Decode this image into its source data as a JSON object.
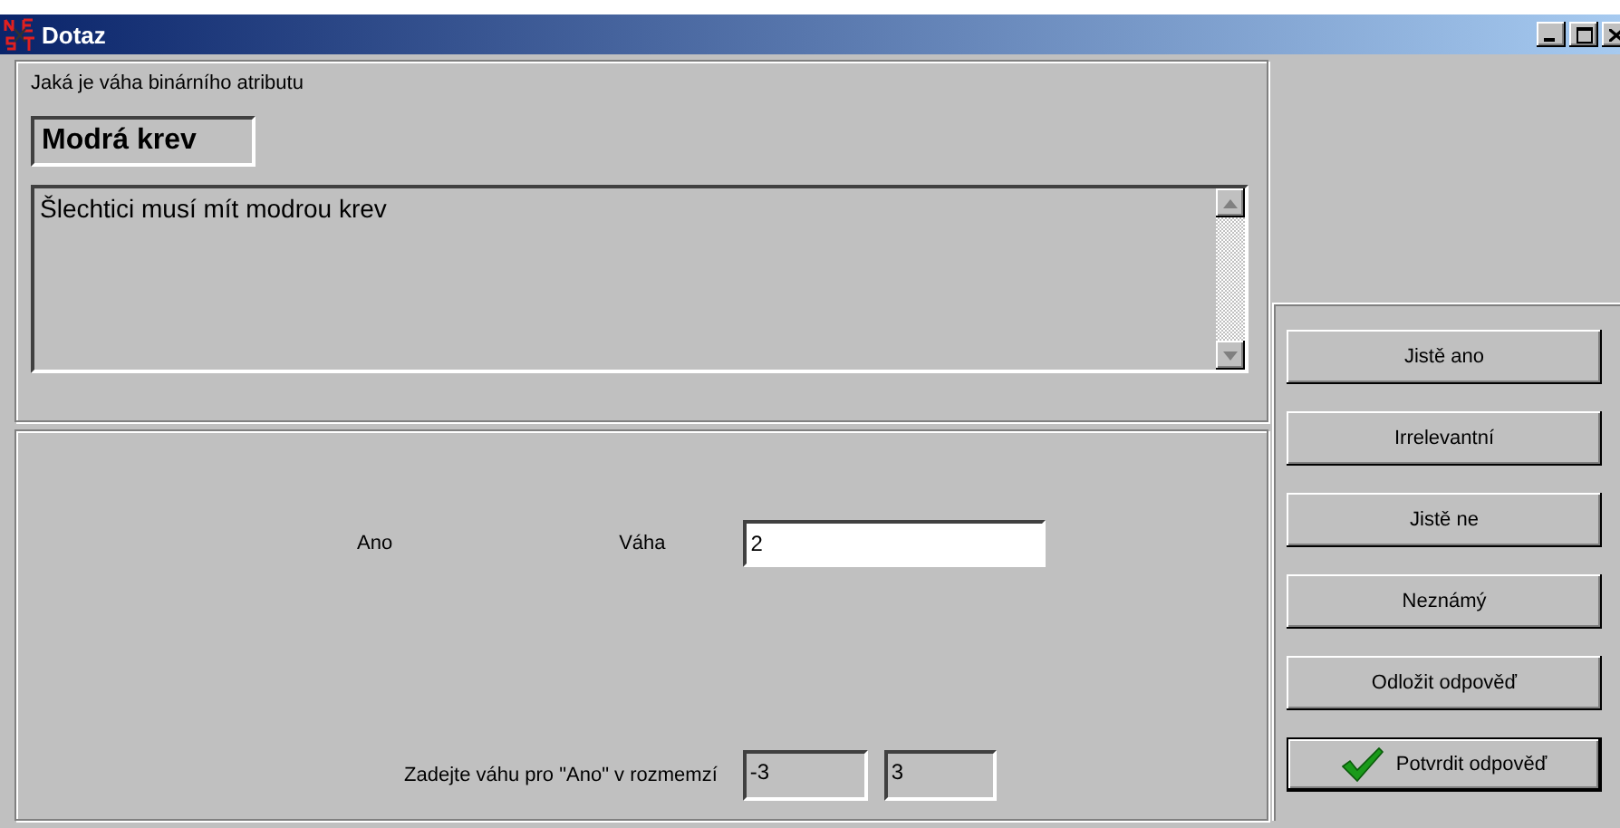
{
  "window": {
    "title": "Dotaz"
  },
  "question": {
    "prompt": "Jaká je váha binárního atributu",
    "attribute": "Modrá krev",
    "description": "Šlechtici musí mít modrou krev"
  },
  "answer": {
    "value_label": "Ano",
    "weight_label": "Váha",
    "weight_value": "2",
    "range_label": "Zadejte váhu pro \"Ano\" v rozmemzí",
    "range_min": "-3",
    "range_max": "3"
  },
  "buttons": [
    {
      "label": "Jistě ano",
      "kind": "plain"
    },
    {
      "label": "Irrelevantní",
      "kind": "plain"
    },
    {
      "label": "Jistě ne",
      "kind": "plain"
    },
    {
      "label": "Neznámý",
      "kind": "plain"
    },
    {
      "label": "Odložit odpověď",
      "kind": "plain"
    },
    {
      "label": "Potvrdit odpověď",
      "kind": "confirm"
    }
  ]
}
